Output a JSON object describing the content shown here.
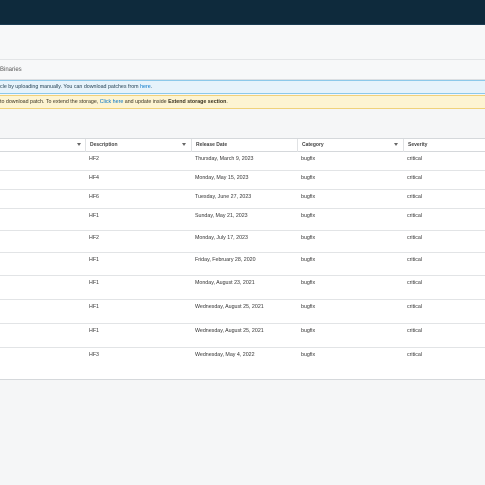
{
  "header": {},
  "tabs": {
    "active_label": "Binaries"
  },
  "info_banner": {
    "text": "cle by uploading manually. You can download patches from ",
    "link": "here",
    "tail": "."
  },
  "warn_banner": {
    "text": "to download patch. To extend the storage, ",
    "link": "Click here",
    "middle": " and update inside ",
    "bold": "Extend storage section",
    "tail": "."
  },
  "table": {
    "columns": [
      "Description",
      "Release Date",
      "Category",
      "Severity"
    ],
    "rows": [
      {
        "description": "HF2",
        "release_date": "Thursday, March 9, 2023",
        "category": "bugfix",
        "severity": "critical"
      },
      {
        "description": "HF4",
        "release_date": "Monday, May 15, 2023",
        "category": "bugfix",
        "severity": "critical"
      },
      {
        "description": "HF6",
        "release_date": "Tuesday, June 27, 2023",
        "category": "bugfix",
        "severity": "critical"
      },
      {
        "description": "HF1",
        "release_date": "Sunday, May 21, 2023",
        "category": "bugfix",
        "severity": "critical"
      },
      {
        "description": "HF2",
        "release_date": "Monday, July 17, 2023",
        "category": "bugfix",
        "severity": "critical"
      },
      {
        "description": "HF1",
        "release_date": "Friday, February 28, 2020",
        "category": "bugfix",
        "severity": "critical"
      },
      {
        "description": "HF1",
        "release_date": "Monday, August 23, 2021",
        "category": "bugfix",
        "severity": "critical"
      },
      {
        "description": "HF1",
        "release_date": "Wednesday, August 25, 2021",
        "category": "bugfix",
        "severity": "critical"
      },
      {
        "description": "HF1",
        "release_date": "Wednesday, August 25, 2021",
        "category": "bugfix",
        "severity": "critical"
      },
      {
        "description": "HF3",
        "release_date": "Wednesday, May 4, 2022",
        "category": "bugfix",
        "severity": "critical"
      }
    ]
  }
}
